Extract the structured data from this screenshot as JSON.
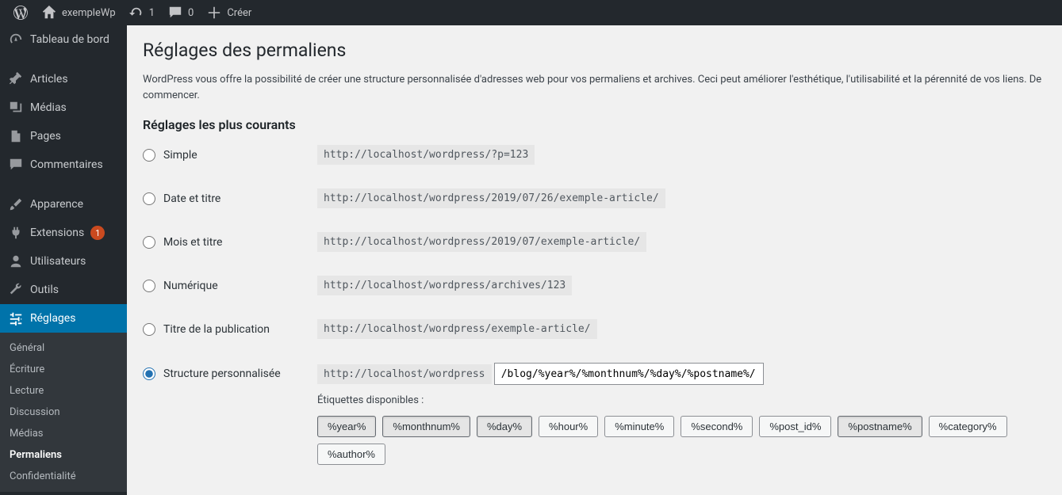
{
  "adminbar": {
    "site_name": "exempleWp",
    "updates": "1",
    "comments": "0",
    "create": "Créer"
  },
  "sidebar": {
    "dashboard": "Tableau de bord",
    "posts": "Articles",
    "media": "Médias",
    "pages": "Pages",
    "comments": "Commentaires",
    "appearance": "Apparence",
    "plugins": "Extensions",
    "plugins_badge": "1",
    "users": "Utilisateurs",
    "tools": "Outils",
    "settings": "Réglages",
    "sub": {
      "general": "Général",
      "writing": "Écriture",
      "reading": "Lecture",
      "discussion": "Discussion",
      "media": "Médias",
      "permalinks": "Permaliens",
      "privacy": "Confidentialité"
    }
  },
  "page": {
    "title": "Réglages des permaliens",
    "intro": "WordPress vous offre la possibilité de créer une structure personnalisée d'adresses web pour vos permaliens et archives. Ceci peut améliorer l'esthétique, l'utilisabilité et la pérennité de vos liens. De commencer.",
    "section": "Réglages les plus courants",
    "options": {
      "simple": {
        "label": "Simple",
        "url": "http://localhost/wordpress/?p=123"
      },
      "day": {
        "label": "Date et titre",
        "url": "http://localhost/wordpress/2019/07/26/exemple-article/"
      },
      "month": {
        "label": "Mois et titre",
        "url": "http://localhost/wordpress/2019/07/exemple-article/"
      },
      "numeric": {
        "label": "Numérique",
        "url": "http://localhost/wordpress/archives/123"
      },
      "postname": {
        "label": "Titre de la publication",
        "url": "http://localhost/wordpress/exemple-article/"
      },
      "custom": {
        "label": "Structure personnalisée",
        "prefix": "http://localhost/wordpress",
        "value": "/blog/%year%/%monthnum%/%day%/%postname%/"
      }
    },
    "tags_label": "Étiquettes disponibles :",
    "tags": [
      "%year%",
      "%monthnum%",
      "%day%",
      "%hour%",
      "%minute%",
      "%second%",
      "%post_id%",
      "%postname%",
      "%category%",
      "%author%"
    ],
    "active_tags": [
      "%year%",
      "%monthnum%",
      "%day%",
      "%postname%"
    ]
  }
}
